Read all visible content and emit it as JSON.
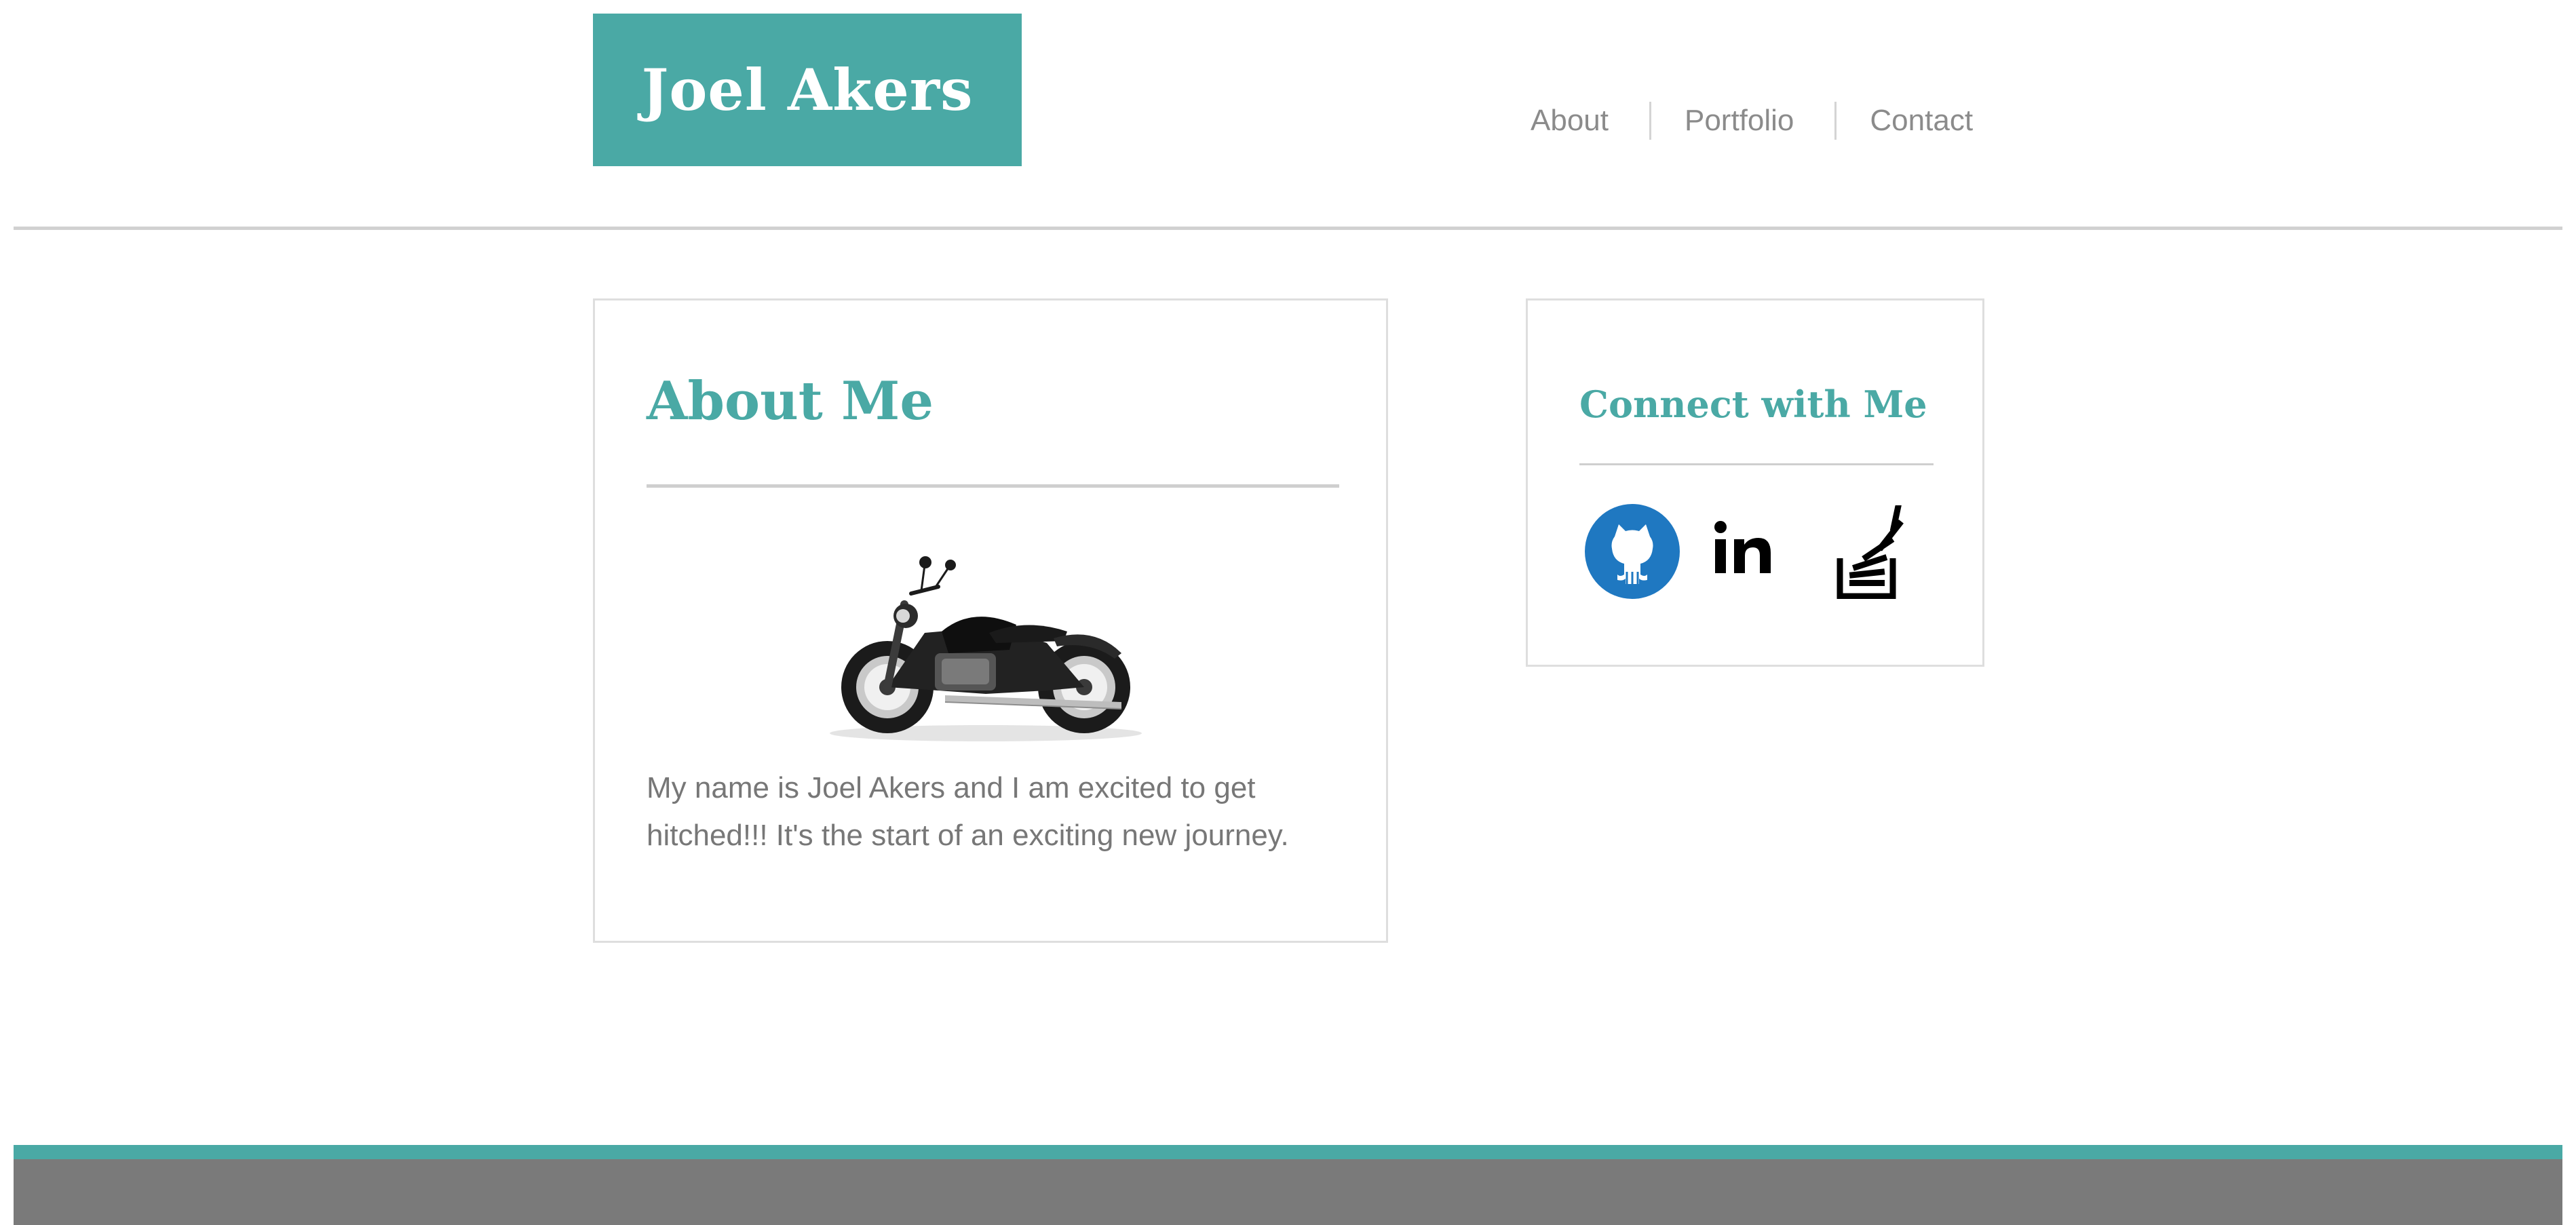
{
  "header": {
    "logo_text": "Joel Akers",
    "nav": [
      {
        "label": "About"
      },
      {
        "label": "Portfolio"
      },
      {
        "label": "Contact"
      }
    ]
  },
  "about": {
    "title": "About Me",
    "image_name": "motorcycle",
    "text": "My name is Joel Akers and I am excited to get hitched!!! It's the start of an exciting new journey."
  },
  "connect": {
    "title": "Connect with Me",
    "links": [
      {
        "icon": "github-icon"
      },
      {
        "icon": "linkedin-icon"
      },
      {
        "icon": "stackoverflow-icon"
      }
    ]
  },
  "colors": {
    "accent": "#4aa9a5",
    "github_blue": "#1f78c1",
    "footer": "#7a7a7a",
    "text": "#777777",
    "nav_text": "#8b8b8b"
  }
}
